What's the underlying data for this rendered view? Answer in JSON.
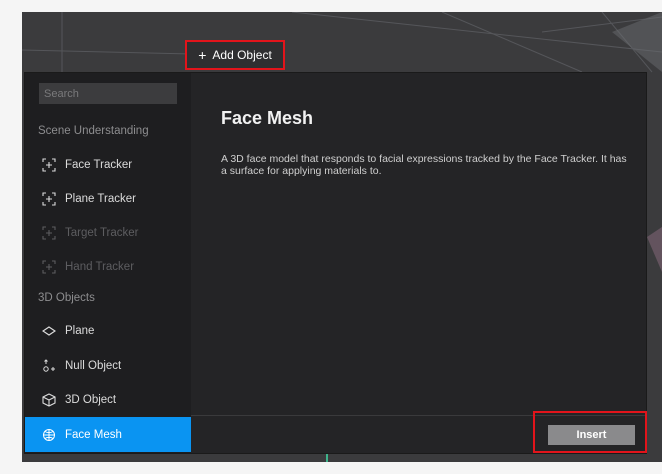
{
  "toolbar": {
    "add_object_label": "Add Object"
  },
  "sidebar": {
    "search_placeholder": "Search",
    "sections": [
      {
        "header": "Scene Understanding",
        "items": [
          {
            "label": "Face Tracker",
            "icon": "tracker-icon",
            "state": "enabled"
          },
          {
            "label": "Plane Tracker",
            "icon": "tracker-icon",
            "state": "enabled"
          },
          {
            "label": "Target Tracker",
            "icon": "tracker-icon",
            "state": "disabled"
          },
          {
            "label": "Hand Tracker",
            "icon": "tracker-icon",
            "state": "disabled"
          }
        ]
      },
      {
        "header": "3D Objects",
        "items": [
          {
            "label": "Plane",
            "icon": "plane-icon",
            "state": "enabled"
          },
          {
            "label": "Null Object",
            "icon": "null-object-icon",
            "state": "enabled"
          },
          {
            "label": "3D Object",
            "icon": "cube-icon",
            "state": "enabled"
          },
          {
            "label": "Face Mesh",
            "icon": "face-mesh-icon",
            "state": "selected"
          }
        ]
      }
    ]
  },
  "detail": {
    "title": "Face Mesh",
    "description": "A 3D face model that responds to facial expressions tracked by the Face Tracker. It has a surface for applying materials to."
  },
  "footer": {
    "insert_label": "Insert"
  },
  "colors": {
    "accent": "#0a94f2",
    "highlight": "#e2141b",
    "panel": "#242426",
    "sidebar": "#1e1e20"
  }
}
